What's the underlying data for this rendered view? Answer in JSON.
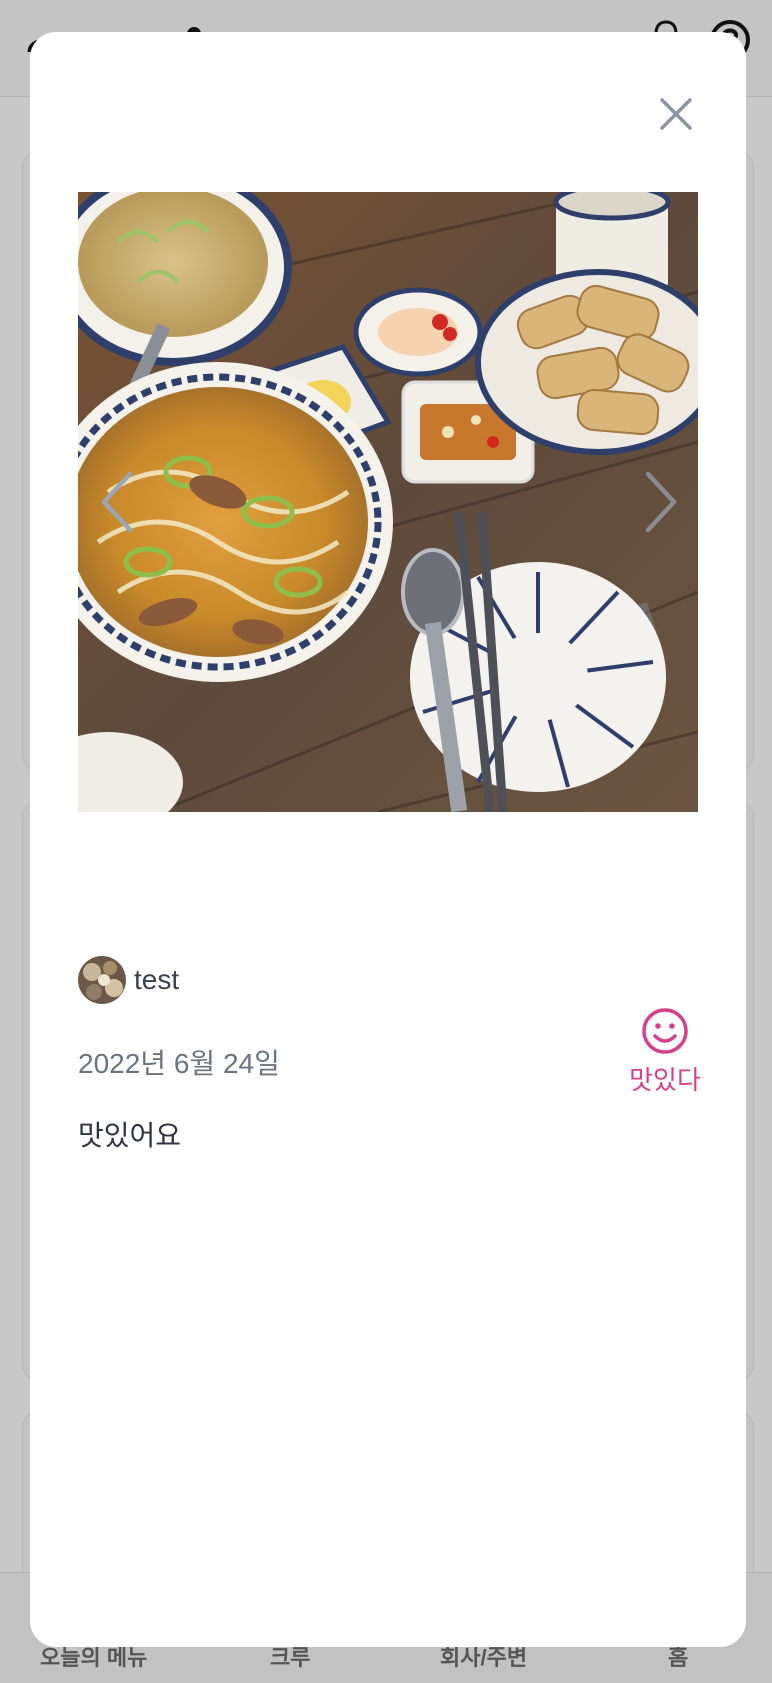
{
  "background": {
    "bottom_nav": [
      "오늘의 메뉴",
      "크루",
      "회사/주변",
      "홈"
    ]
  },
  "modal": {
    "close_icon": "close-icon",
    "carousel": {
      "prev_icon": "chevron-left-icon",
      "next_icon": "chevron-right-icon"
    },
    "post": {
      "author": "test",
      "date": "2022년 6월 24일",
      "text": "맛있어요",
      "reaction_label": "맛있다",
      "reaction_icon": "smile-icon"
    }
  },
  "colors": {
    "accent": "#d4418a",
    "text_primary": "#2f3440",
    "text_secondary": "#6b7280",
    "close_icon": "#8a94a3"
  }
}
